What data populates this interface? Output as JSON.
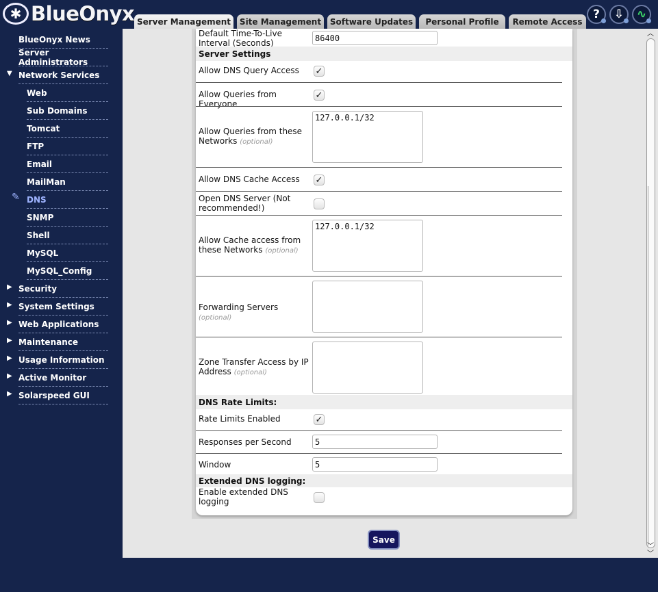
{
  "app": {
    "logo_mark": "✱",
    "logo_text": "BlueOnyx"
  },
  "tabs": [
    {
      "label": "Server Management",
      "active": true
    },
    {
      "label": "Site Management"
    },
    {
      "label": "Software Updates"
    },
    {
      "label": "Personal Profile"
    },
    {
      "label": "Remote Access"
    }
  ],
  "header_buttons": {
    "help": "?",
    "download": "⇩",
    "monitor": "∿"
  },
  "sidebar": {
    "items": [
      {
        "label": "BlueOnyx News"
      },
      {
        "label": "Server Administrators"
      },
      {
        "label": "Network Services",
        "expanded": true
      },
      {
        "label": "Web"
      },
      {
        "label": "Sub Domains"
      },
      {
        "label": "Tomcat"
      },
      {
        "label": "FTP"
      },
      {
        "label": "Email"
      },
      {
        "label": "MailMan"
      },
      {
        "label": "DNS",
        "active": true
      },
      {
        "label": "SNMP"
      },
      {
        "label": "Shell"
      },
      {
        "label": "MySQL"
      },
      {
        "label": "MySQL_Config"
      },
      {
        "label": "Security"
      },
      {
        "label": "System Settings"
      },
      {
        "label": "Web Applications"
      },
      {
        "label": "Maintenance"
      },
      {
        "label": "Usage Information"
      },
      {
        "label": "Active Monitor"
      },
      {
        "label": "Solarspeed GUI"
      }
    ]
  },
  "form": {
    "ttl": {
      "label": "Default Time-To-Live Interval (Seconds)",
      "value": "86400"
    },
    "server_settings": {
      "heading": "Server Settings"
    },
    "allow_dns_query": {
      "label": "Allow DNS Query Access",
      "checked": true
    },
    "allow_queries_everyone": {
      "label": "Allow Queries from Everyone",
      "checked": true
    },
    "allow_queries_networks": {
      "label": "Allow Queries from these Networks",
      "optional": "(optional)",
      "value": "127.0.0.1/32"
    },
    "allow_cache": {
      "label": "Allow DNS Cache Access",
      "checked": true
    },
    "open_dns": {
      "label": "Open DNS Server (Not recommended!)",
      "checked": false
    },
    "cache_networks": {
      "label": "Allow Cache access from these Networks",
      "optional": "(optional)",
      "value": "127.0.0.1/32"
    },
    "forwarders": {
      "label": "Forwarding Servers",
      "optional": "(optional)",
      "value": ""
    },
    "zone_transfer": {
      "label": "Zone Transfer Access by IP Address",
      "optional": "(optional)",
      "value": ""
    },
    "rate_limits": {
      "heading": "DNS Rate Limits:"
    },
    "rate_enabled": {
      "label": "Rate Limits Enabled",
      "checked": true
    },
    "responses_per_second": {
      "label": "Responses per Second",
      "value": "5"
    },
    "window": {
      "label": "Window",
      "value": "5"
    },
    "extended_logging": {
      "heading": "Extended DNS logging:"
    },
    "enable_extended": {
      "label": "Enable extended DNS logging",
      "checked": false
    }
  },
  "save_label": "Save",
  "check_glyph": "✓"
}
